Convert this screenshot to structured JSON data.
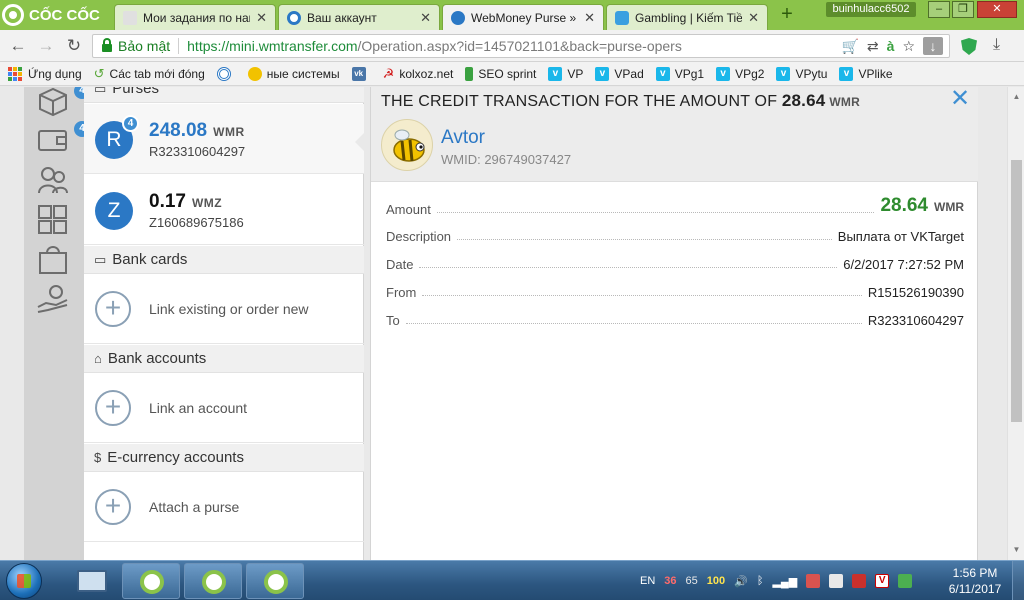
{
  "browser": {
    "brand": "CỐC CỐC",
    "tabs": [
      {
        "label": "Мои задания по нак",
        "icon_color": "#e0e0e0"
      },
      {
        "label": "Ваш аккаунт",
        "icon_color": "#2b78c5"
      },
      {
        "label": "WebMoney Purse » T",
        "icon_color": "#2b78c5"
      },
      {
        "label": "Gambling | Kiếm Tiền",
        "icon_color": "#3aa0e0"
      }
    ],
    "user": "buinhulacc6502",
    "secure_label": "Bảo mật",
    "url_host": "https://mini.wmtransfer.com",
    "url_rest": "/Operation.aspx?id=1457021101&back=purse-opers",
    "bookmarks": [
      {
        "label": "Ứng dụng",
        "icon": "apps-grid-icon",
        "color": "#e94a35"
      },
      {
        "label": "Các tab mới đóng",
        "icon": "history-icon",
        "color": "#5aa83a"
      },
      {
        "label": "",
        "icon": "target-icon",
        "color": "#2b78c5"
      },
      {
        "label": "ные системы",
        "icon": "coins-icon",
        "color": "#f2c200"
      },
      {
        "label": "",
        "icon": "vk-icon",
        "color": "#4a76a8"
      },
      {
        "label": "kolxoz.net",
        "icon": "sickle-icon",
        "color": "#d11a1a"
      },
      {
        "label": "SEO sprint",
        "icon": "seo-sprint-icon",
        "color": "#3aa140"
      },
      {
        "label": "VP",
        "icon": "vimeo-icon",
        "color": "#1ab7ea"
      },
      {
        "label": "VPad",
        "icon": "vimeo-icon",
        "color": "#1ab7ea"
      },
      {
        "label": "VPg1",
        "icon": "vimeo-icon",
        "color": "#1ab7ea"
      },
      {
        "label": "VPg2",
        "icon": "vimeo-icon",
        "color": "#1ab7ea"
      },
      {
        "label": "VPytu",
        "icon": "vimeo-icon",
        "color": "#1ab7ea"
      },
      {
        "label": "VPlike",
        "icon": "vimeo-icon",
        "color": "#1ab7ea"
      }
    ]
  },
  "sidebar": {
    "badges": {
      "purses": "4",
      "wallet": "4"
    }
  },
  "wallets": {
    "purses_title": "Purses",
    "purses": [
      {
        "letter": "R",
        "badge": "4",
        "amount": "248.08",
        "currency": "WMR",
        "id": "R323310604297"
      },
      {
        "letter": "Z",
        "amount": "0.17",
        "currency": "WMZ",
        "id": "Z160689675186"
      }
    ],
    "bank_cards_title": "Bank cards",
    "bank_cards_action": "Link existing or order new",
    "bank_accounts_title": "Bank accounts",
    "bank_accounts_action": "Link an account",
    "ecurrency_title": "E-currency accounts",
    "ecurrency_action": "Attach a purse"
  },
  "transaction": {
    "title_prefix": "THE CREDIT TRANSACTION FOR THE AMOUNT OF",
    "title_amount": "28.64",
    "title_currency": "WMR",
    "contact_name": "Avtor",
    "contact_wmid": "WMID: 296749037427",
    "fields": {
      "amount_label": "Amount",
      "amount_value": "28.64",
      "amount_currency": "WMR",
      "description_label": "Description",
      "description_value": "Выплата от VKTarget",
      "date_label": "Date",
      "date_value": "6/2/2017 7:27:52 PM",
      "from_label": "From",
      "from_value": "R151526190390",
      "to_label": "To",
      "to_value": "R323310604297"
    },
    "colors": {
      "accent": "#2b78c5",
      "amount_green": "#2e8b2e"
    }
  },
  "taskbar": {
    "lang": "EN",
    "tray_num1": "36",
    "tray_num2": "65",
    "tray_num3": "100",
    "time": "1:56 PM",
    "date": "6/11/2017"
  }
}
